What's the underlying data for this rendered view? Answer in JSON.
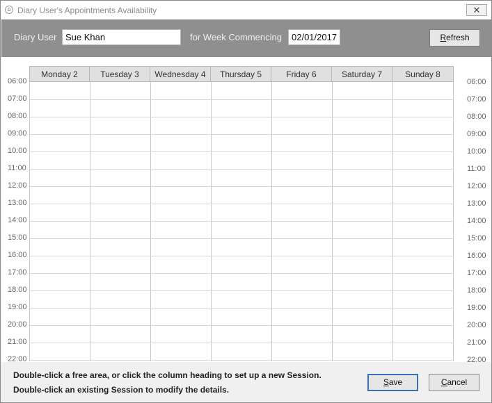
{
  "window": {
    "title": "Diary User's Appointments Availability",
    "close_glyph": "✕"
  },
  "header": {
    "user_label": "Diary User",
    "user_value": "Sue Khan",
    "week_label": "for Week Commencing",
    "week_value": "02/01/2017",
    "refresh_label": "Refresh"
  },
  "days": [
    "Monday 2",
    "Tuesday 3",
    "Wednesday 4",
    "Thursday 5",
    "Friday 6",
    "Saturday 7",
    "Sunday 8"
  ],
  "hours": [
    "06:00",
    "07:00",
    "08:00",
    "09:00",
    "10:00",
    "11:00",
    "12:00",
    "13:00",
    "14:00",
    "15:00",
    "16:00",
    "17:00",
    "18:00",
    "19:00",
    "20:00",
    "21:00",
    "22:00"
  ],
  "footer": {
    "hint_1": "Double-click a free area, or click the column heading to set up a new Session.",
    "hint_2": "Double-click an existing Session to modify  the details.",
    "save_label": "Save",
    "cancel_label": "Cancel"
  }
}
